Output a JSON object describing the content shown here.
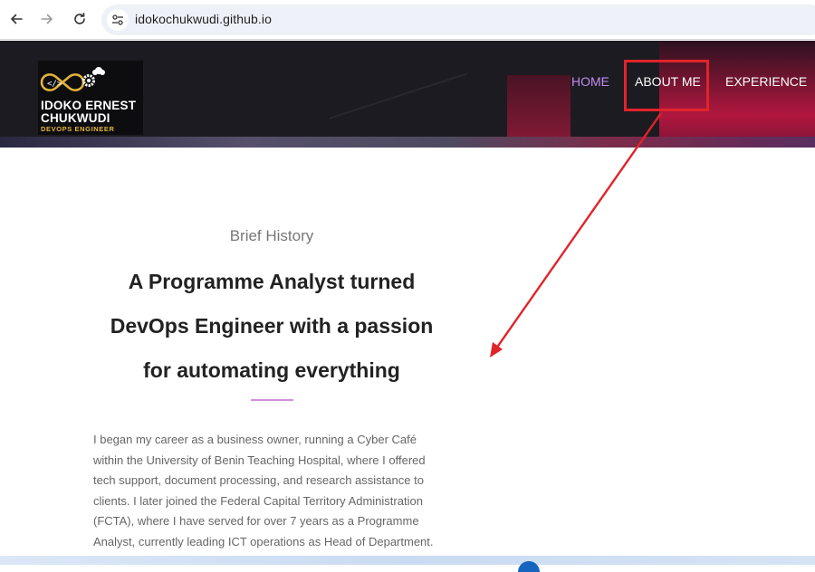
{
  "browser": {
    "url": "idokochukwudi.github.io"
  },
  "header": {
    "logo": {
      "name_line1": "IDOKO ERNEST",
      "name_line2": "CHUKWUDI",
      "tagline": "DEVOPS ENGINEER"
    },
    "nav": [
      {
        "label": "HOME",
        "active": true
      },
      {
        "label": "ABOUT ME",
        "active": false
      },
      {
        "label": "EXPERIENCE",
        "active": false
      }
    ]
  },
  "colors": {
    "nav_active": "#c48cf0",
    "annotation": "#e0242a",
    "divider": "#d68fe0"
  },
  "about": {
    "kicker": "Brief History",
    "headline_lines": [
      "A Programme Analyst turned",
      "DevOps Engineer with a passion",
      "for automating everything"
    ],
    "bio_lines": [
      "I began my career as a business owner, running a Cyber Café",
      "within the University of Benin Teaching Hospital, where I offered",
      "tech support, document processing, and research assistance to",
      "clients. I later joined the Federal Capital Territory Administration",
      "(FCTA), where I have served for over 7 years as a Programme",
      "Analyst, currently leading ICT operations as Head of Department."
    ]
  }
}
